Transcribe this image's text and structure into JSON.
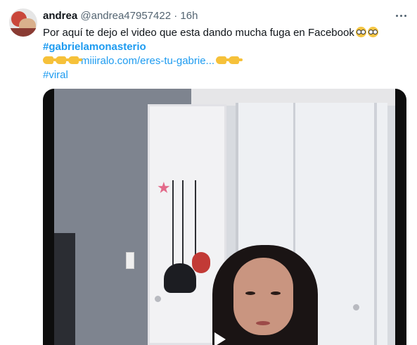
{
  "tweet": {
    "display_name": "andrea",
    "handle": "@andrea47957422",
    "separator": "·",
    "time": "16h",
    "line1": "Por aquí te dejo el video que esta dando mucha fuga en Facebook",
    "hashtag1": "#gabrielamonasterio",
    "link": "miiiralo.com/eres-tu-gabrie...",
    "hashtag2": "#viral"
  },
  "icons": {
    "more": "more-options-icon",
    "emoji_nerd": "nerd-face-emoji",
    "emoji_point": "pointing-hand-emoji"
  }
}
